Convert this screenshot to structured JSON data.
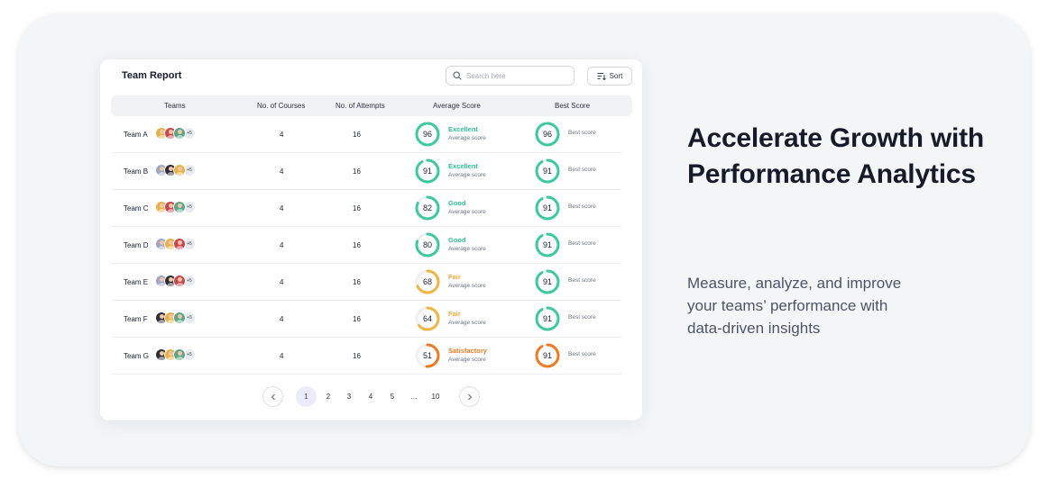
{
  "card": {
    "title": "Team Report",
    "search_placeholder": "Search here",
    "sort_label": "Sort"
  },
  "table": {
    "headers": [
      "Teams",
      "No. of Courses",
      "No. of Attempts",
      "Average Score",
      "Best Score"
    ],
    "rows": [
      {
        "team": "Team A",
        "more": "+5",
        "courses": "4",
        "attempts": "16",
        "avg": "96",
        "grade": "Excellent",
        "avg_label": "Average score",
        "best": "96",
        "best_label": "Best score",
        "avg_fraction": 0.96,
        "best_fraction": 0.96,
        "avg_color": "#3dc9a0",
        "best_color": "#3dc9a0",
        "grade_color": "#2fbf96",
        "avatars": [
          "#e8b24a",
          "#c9474e",
          "#5aa68a"
        ]
      },
      {
        "team": "Team B",
        "more": "+5",
        "courses": "4",
        "attempts": "16",
        "avg": "91",
        "grade": "Excellent",
        "avg_label": "Average score",
        "best": "91",
        "best_label": "Best score",
        "avg_fraction": 0.91,
        "best_fraction": 0.91,
        "avg_color": "#3dc9a0",
        "best_color": "#3dc9a0",
        "grade_color": "#2fbf96",
        "avatars": [
          "#9da6c8",
          "#2f2f3a",
          "#e8b24a"
        ]
      },
      {
        "team": "Team C",
        "more": "+5",
        "courses": "4",
        "attempts": "16",
        "avg": "82",
        "grade": "Good",
        "avg_label": "Average score",
        "best": "91",
        "best_label": "Best score",
        "avg_fraction": 0.82,
        "best_fraction": 0.91,
        "avg_color": "#3dc9a0",
        "best_color": "#3dc9a0",
        "grade_color": "#2fbf96",
        "avatars": [
          "#e8b24a",
          "#c9474e",
          "#5aa68a"
        ]
      },
      {
        "team": "Team D",
        "more": "+5",
        "courses": "4",
        "attempts": "16",
        "avg": "80",
        "grade": "Good",
        "avg_label": "Average score",
        "best": "91",
        "best_label": "Best score",
        "avg_fraction": 0.8,
        "best_fraction": 0.91,
        "avg_color": "#3dc9a0",
        "best_color": "#3dc9a0",
        "grade_color": "#2fbf96",
        "avatars": [
          "#9da6c8",
          "#e8b24a",
          "#c9474e"
        ]
      },
      {
        "team": "Team E",
        "more": "+5",
        "courses": "4",
        "attempts": "16",
        "avg": "68",
        "grade": "Fair",
        "avg_label": "Average score",
        "best": "91",
        "best_label": "Best score",
        "avg_fraction": 0.68,
        "best_fraction": 0.91,
        "avg_color": "#f2b544",
        "best_color": "#3dc9a0",
        "grade_color": "#f2a93b",
        "avatars": [
          "#9da6c8",
          "#2f2f3a",
          "#c9474e"
        ]
      },
      {
        "team": "Team F",
        "more": "+5",
        "courses": "4",
        "attempts": "16",
        "avg": "64",
        "grade": "Fair",
        "avg_label": "Average score",
        "best": "91",
        "best_label": "Best score",
        "avg_fraction": 0.64,
        "best_fraction": 0.91,
        "avg_color": "#f2b544",
        "best_color": "#3dc9a0",
        "grade_color": "#f2a93b",
        "avatars": [
          "#2f2f3a",
          "#e8b24a",
          "#5aa68a"
        ]
      },
      {
        "team": "Team G",
        "more": "+5",
        "courses": "4",
        "attempts": "16",
        "avg": "51",
        "grade": "Satisfactory",
        "avg_label": "Average score",
        "best": "91",
        "best_label": "Best score",
        "avg_fraction": 0.51,
        "best_fraction": 0.91,
        "avg_color": "#f07a22",
        "best_color": "#f07a22",
        "grade_color": "#ee7a1f",
        "avatars": [
          "#2f2f3a",
          "#e8b24a",
          "#5aa68a"
        ]
      }
    ]
  },
  "pagination": {
    "pages": [
      "1",
      "2",
      "3",
      "4",
      "5",
      "...",
      "10"
    ],
    "active": "1"
  },
  "hero": {
    "headline": "Accelerate Growth with Performance Analytics",
    "subtext": "Measure, analyze, and improve your teams’ performance with data-driven insights"
  },
  "icons": {
    "search": "search-icon",
    "sort": "sort-icon",
    "prev": "chevron-left-icon",
    "next": "chevron-right-icon"
  }
}
